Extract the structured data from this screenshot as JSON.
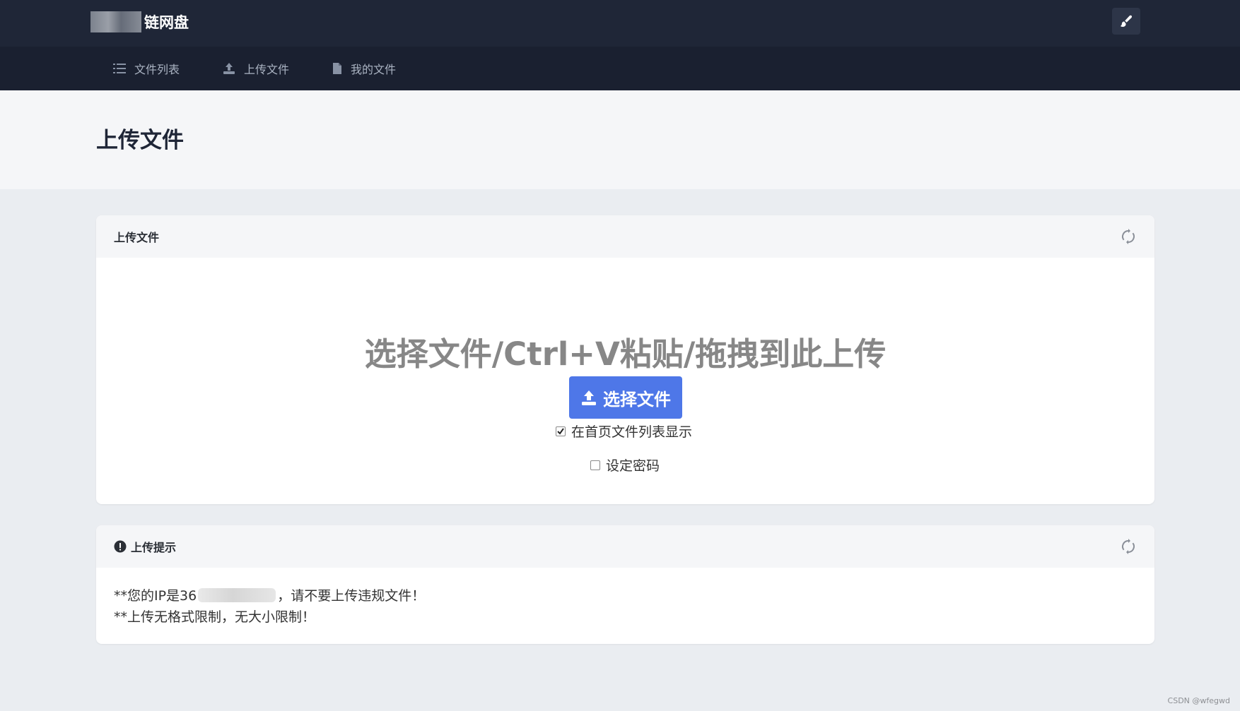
{
  "brand": {
    "title": "链网盘"
  },
  "nav": {
    "items": [
      {
        "label": "文件列表",
        "icon": "list-icon"
      },
      {
        "label": "上传文件",
        "icon": "upload-icon"
      },
      {
        "label": "我的文件",
        "icon": "file-icon"
      }
    ]
  },
  "page": {
    "title": "上传文件"
  },
  "upload_card": {
    "header": "上传文件",
    "headline": "选择文件/Ctrl+V粘贴/拖拽到此上传",
    "button_label": "选择文件",
    "option_show_on_home": {
      "label": "在首页文件列表显示",
      "checked": true
    },
    "option_set_password": {
      "label": "设定密码",
      "checked": false
    }
  },
  "tips_card": {
    "header": "上传提示",
    "line1_prefix": "**您的IP是36",
    "line1_suffix": "，请不要上传违规文件！",
    "line2": "**上传无格式限制，无大小限制！"
  },
  "watermark": "CSDN @wfegwd",
  "colors": {
    "topbar": "#1f2637",
    "navbar": "#1a2030",
    "accent": "#4e77e8"
  }
}
